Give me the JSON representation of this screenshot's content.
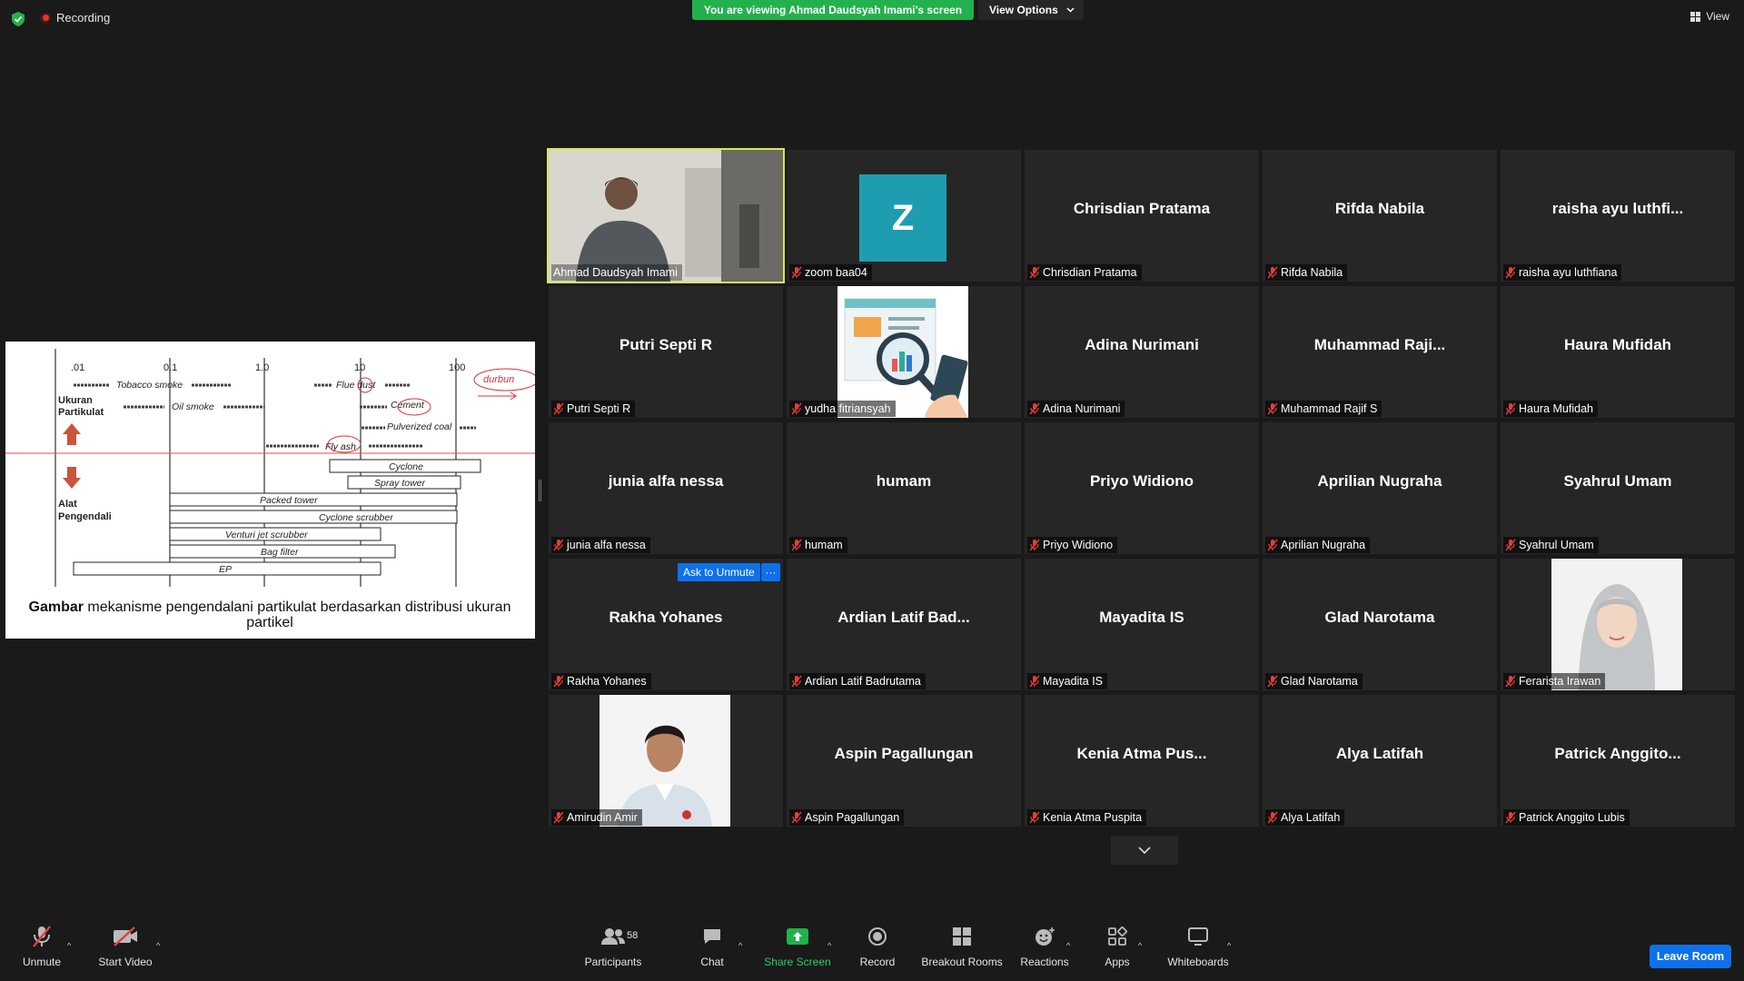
{
  "top": {
    "recording": "Recording",
    "banner": "You are viewing Ahmad Daudsyah Imami's screen",
    "view_options": "View Options",
    "view": "View"
  },
  "share": {
    "axis_ticks": [
      ".01",
      "0.1",
      "1.0",
      "10",
      "100"
    ],
    "left_top": [
      "Ukuran",
      "Partikulat"
    ],
    "left_bottom": [
      "Alat",
      "Pengendali"
    ],
    "particles": [
      "Tobacco smoke",
      "Oil smoke",
      "Flue dust",
      "Cement",
      "Pulverized coal",
      "Fly ash"
    ],
    "devices": [
      "Cyclone",
      "Spray tower",
      "Packed tower",
      "Cyclone scrubber",
      "Venturi jet scrubber",
      "Bag filter",
      "EP"
    ],
    "handwriting": "durbun",
    "caption_bold": "Gambar",
    "caption_line1": " mekanisme pengendalani partikulat berdasarkan distribusi ukuran",
    "caption_line2": "partikel"
  },
  "participants": [
    {
      "big": "",
      "label": "Ahmad Daudsyah Imami",
      "video": "presenter",
      "muted": false
    },
    {
      "big": "",
      "label": "zoom baa04",
      "avatar": "Z",
      "muted": true
    },
    {
      "big": "Chrisdian Pratama",
      "label": "Chrisdian Pratama",
      "muted": true
    },
    {
      "big": "Rifda Nabila",
      "label": "Rifda Nabila",
      "muted": true
    },
    {
      "big": "raisha ayu luthfi...",
      "label": "raisha ayu luthfiana",
      "muted": true
    },
    {
      "big": "Putri Septi R",
      "label": "Putri Septi R",
      "muted": true
    },
    {
      "big": "",
      "label": "yudha fitriansyah",
      "video": "chart-illustration",
      "muted": true
    },
    {
      "big": "Adina Nurimani",
      "label": "Adina Nurimani",
      "muted": true
    },
    {
      "big": "Muhammad  Raji...",
      "label": "Muhammad Rajif S",
      "muted": true
    },
    {
      "big": "Haura Mufidah",
      "label": "Haura Mufidah",
      "muted": true
    },
    {
      "big": "junia alfa nessa",
      "label": "junia alfa nessa",
      "muted": true
    },
    {
      "big": "humam",
      "label": "humam",
      "muted": true
    },
    {
      "big": "Priyo Widiono",
      "label": "Priyo Widiono",
      "muted": true
    },
    {
      "big": "Aprilian Nugraha",
      "label": "Aprilian Nugraha",
      "muted": true
    },
    {
      "big": "Syahrul Umam",
      "label": "Syahrul Umam",
      "muted": true
    },
    {
      "big": "Rakha Yohanes",
      "label": "Rakha Yohanes",
      "muted": true,
      "hover": true
    },
    {
      "big": "Ardian Latif Bad...",
      "label": "Ardian Latif Badrutama",
      "muted": true
    },
    {
      "big": "Mayadita IS",
      "label": "Mayadita IS",
      "muted": true
    },
    {
      "big": "Glad Narotama",
      "label": "Glad Narotama",
      "muted": true
    },
    {
      "big": "",
      "label": "Ferarista Irawan",
      "video": "portrait-hijab",
      "muted": true
    },
    {
      "big": "",
      "label": "Amirudin Amir",
      "video": "portrait-man",
      "muted": true
    },
    {
      "big": "Aspin Pagallungan",
      "label": "Aspin Pagallungan",
      "muted": true
    },
    {
      "big": "Kenia Atma Pus...",
      "label": "Kenia Atma Puspita",
      "muted": true
    },
    {
      "big": "Alya Latifah",
      "label": "Alya Latifah",
      "muted": true
    },
    {
      "big": "Patrick  Anggito...",
      "label": "Patrick Anggito Lubis",
      "muted": true
    }
  ],
  "hover_actions": {
    "ask_to_unmute": "Ask to Unmute",
    "more": "···"
  },
  "toolbar": {
    "unmute": "Unmute",
    "start_video": "Start Video",
    "participants": "Participants",
    "participants_count": "58",
    "chat": "Chat",
    "share_screen": "Share Screen",
    "record": "Record",
    "breakout_rooms": "Breakout Rooms",
    "reactions": "Reactions",
    "apps": "Apps",
    "whiteboards": "Whiteboards",
    "leave_room": "Leave Room"
  },
  "colors": {
    "banner_green": "#23b14d",
    "active_speaker": "#d6e94d",
    "accent_blue": "#0e71eb",
    "muted_red": "#e0403a",
    "avatar_teal": "#1f9db0"
  }
}
